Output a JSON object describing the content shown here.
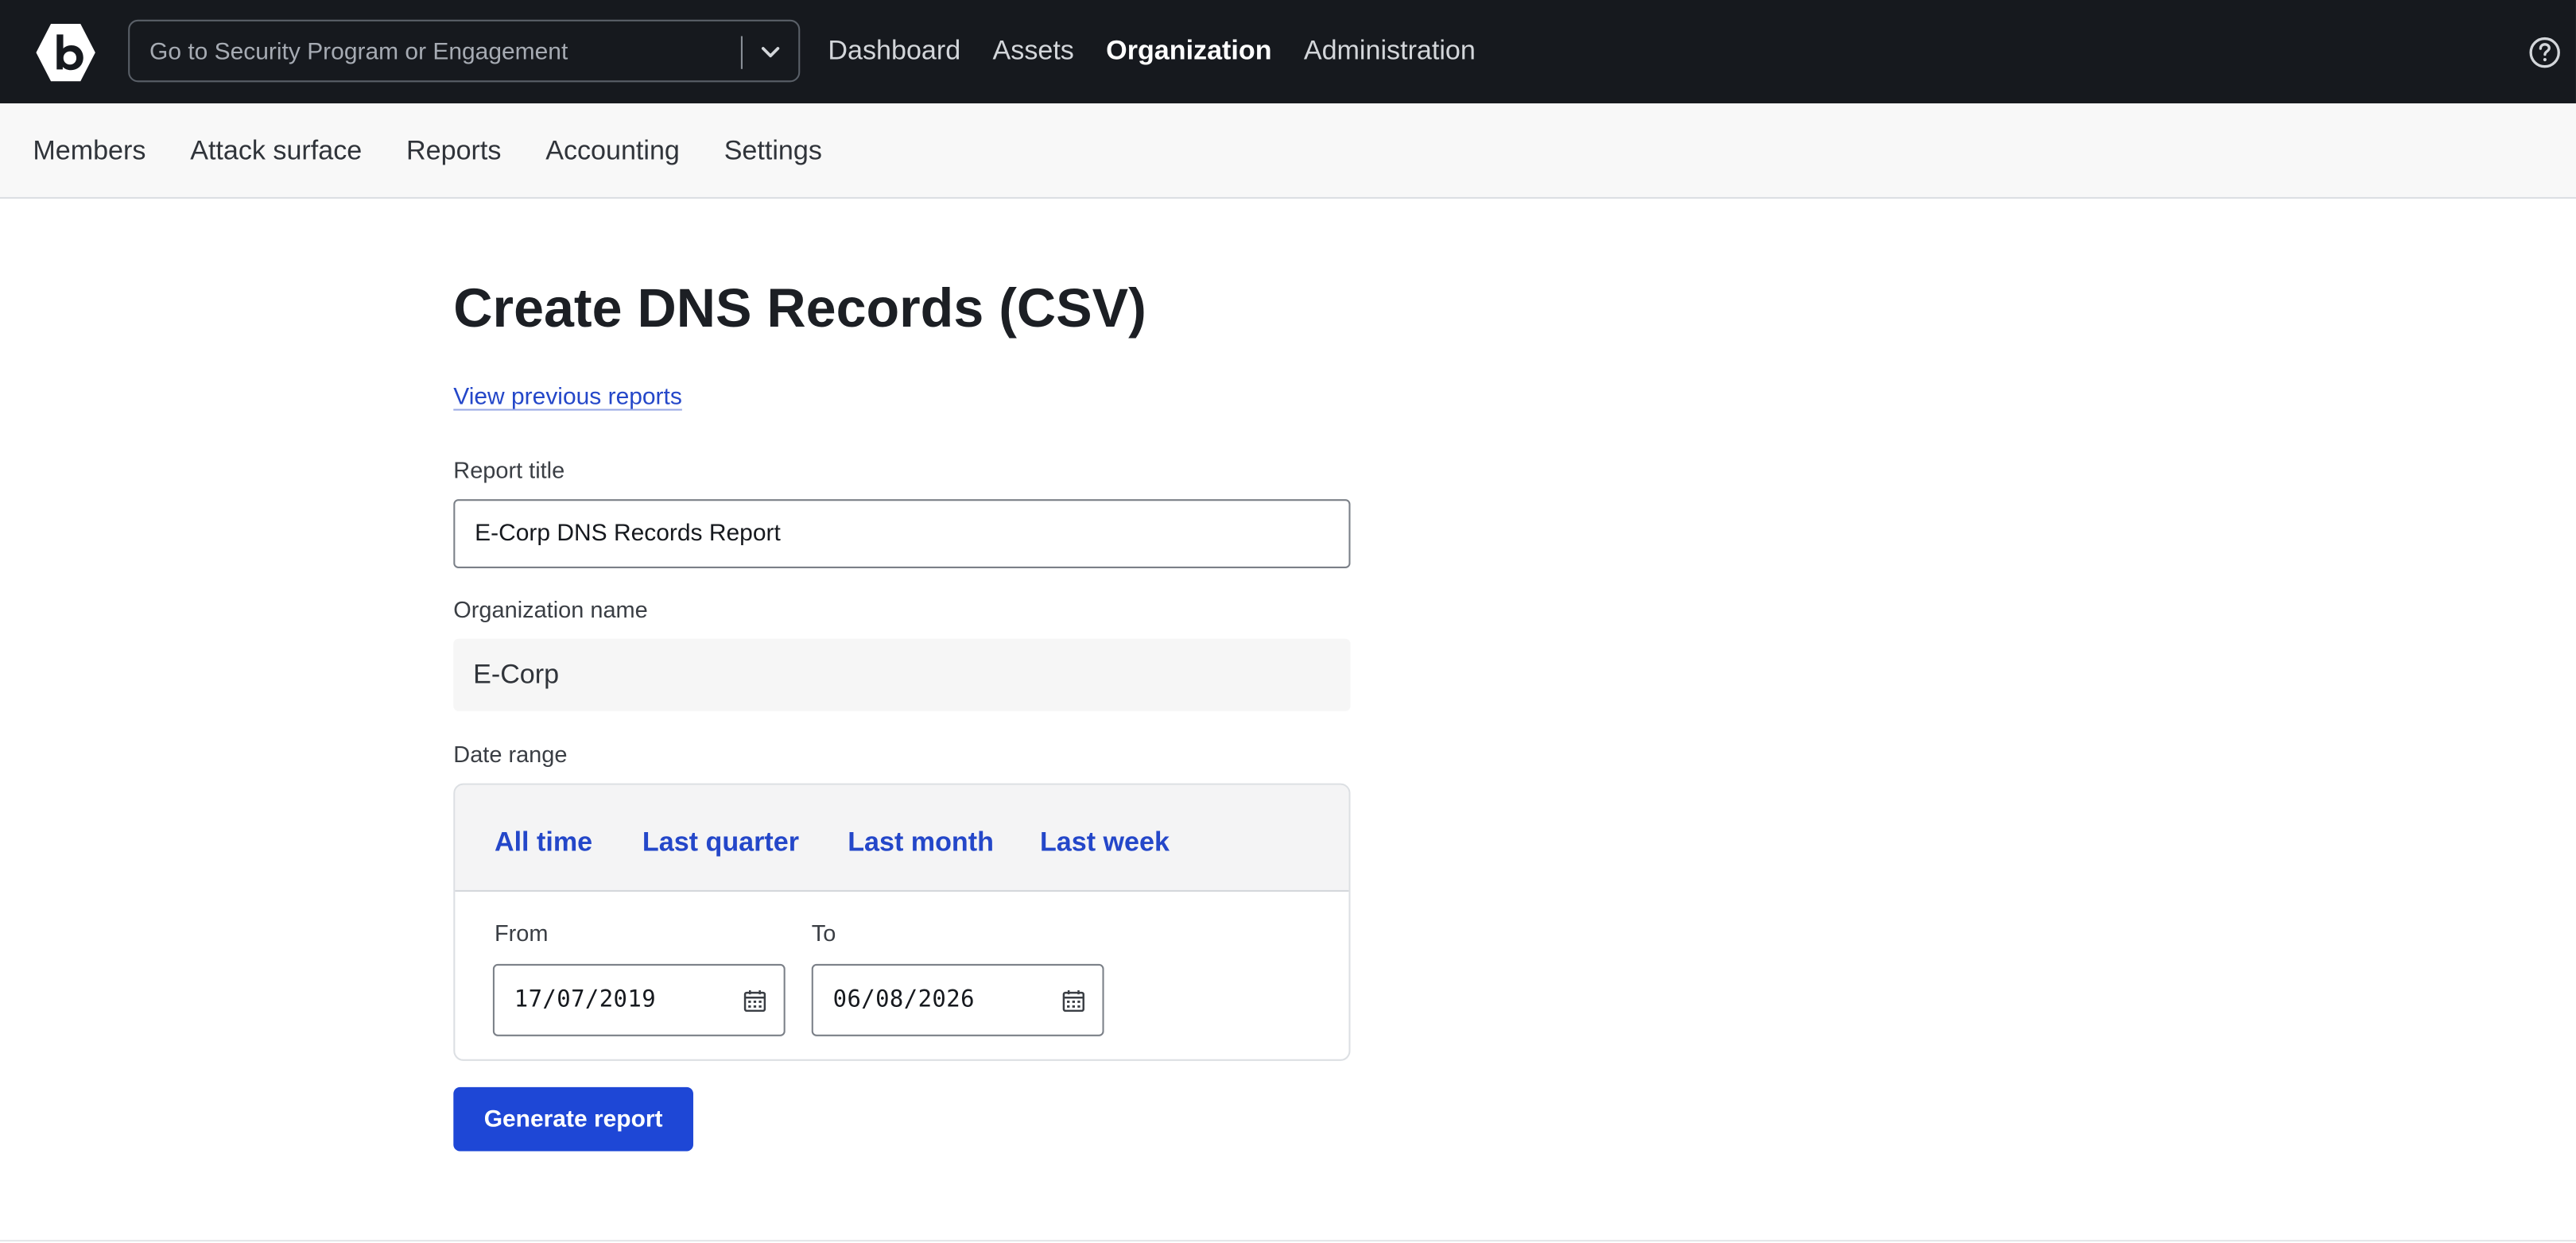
{
  "topbar": {
    "search_placeholder": "Go to Security Program or Engagement",
    "nav": [
      {
        "label": "Dashboard",
        "active": false
      },
      {
        "label": "Assets",
        "active": false
      },
      {
        "label": "Organization",
        "active": true
      },
      {
        "label": "Administration",
        "active": false
      }
    ],
    "icons": {
      "logo": "bugcrowd-logo-icon",
      "chevron": "chevron-down-icon",
      "help": "help-circle-icon"
    }
  },
  "subnav": {
    "items": [
      "Members",
      "Attack surface",
      "Reports",
      "Accounting",
      "Settings"
    ]
  },
  "main": {
    "title": "Create DNS Records (CSV)",
    "previous_reports_link": "View previous reports",
    "report_title_label": "Report title",
    "report_title_value": "E-Corp DNS Records Report",
    "organization_label": "Organization name",
    "organization_value": "E-Corp",
    "date_range_label": "Date range",
    "range_options": [
      "All time",
      "Last quarter",
      "Last month",
      "Last week"
    ],
    "from_label": "From",
    "from_value": "17/07/2019",
    "to_label": "To",
    "to_value": "06/08/2026",
    "generate_button": "Generate report"
  },
  "colors": {
    "topbar_bg": "#16191e",
    "link_blue": "#2447c9",
    "button_blue": "#1e47d6"
  }
}
